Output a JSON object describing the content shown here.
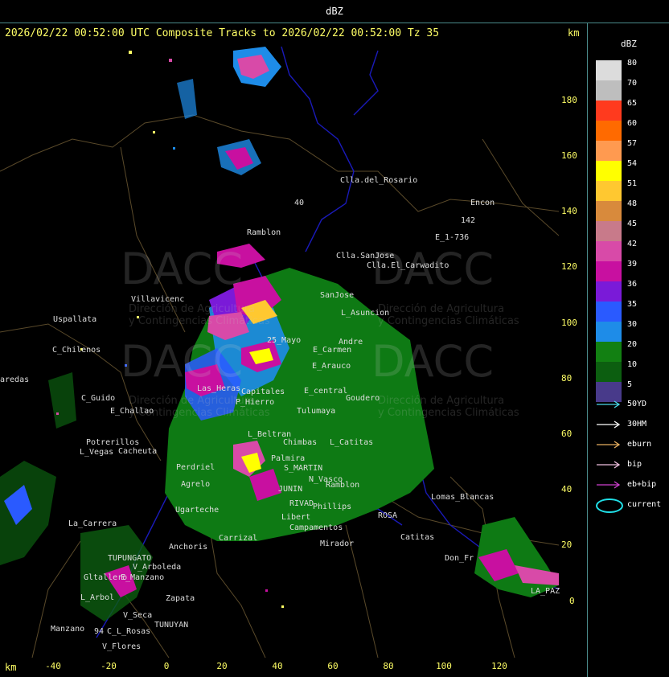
{
  "header": {
    "label": "dBZ"
  },
  "title": "2026/02/22 00:52:00 UTC Composite Tracks to 2026/02/22 00:52:00 Tz 35",
  "km_top": "km",
  "km_bottom": "km",
  "y_ticks": [
    "180",
    "160",
    "140",
    "120",
    "100",
    "80",
    "60",
    "40",
    "20",
    "0"
  ],
  "x_ticks": [
    "-40",
    "-20",
    "0",
    "20",
    "40",
    "60",
    "80",
    "100",
    "120"
  ],
  "legend": {
    "title": "dBZ",
    "levels": [
      {
        "label": "80",
        "color": "#dcdcdc"
      },
      {
        "label": "70",
        "color": "#bebebe"
      },
      {
        "label": "65",
        "color": "#ff3a1e"
      },
      {
        "label": "60",
        "color": "#ff6a00"
      },
      {
        "label": "57",
        "color": "#ff9a50"
      },
      {
        "label": "54",
        "color": "#ffff00"
      },
      {
        "label": "51",
        "color": "#ffc830"
      },
      {
        "label": "48",
        "color": "#d88a3c"
      },
      {
        "label": "45",
        "color": "#c87a8a"
      },
      {
        "label": "42",
        "color": "#d84aa8"
      },
      {
        "label": "39",
        "color": "#c810a0"
      },
      {
        "label": "36",
        "color": "#7a1ad8"
      },
      {
        "label": "35",
        "color": "#2a5aff"
      },
      {
        "label": "30",
        "color": "#1e8ce8"
      },
      {
        "label": "20",
        "color": "#128012"
      },
      {
        "label": "10",
        "color": "#0c5e10"
      },
      {
        "label": "5",
        "color": "#483a8a"
      }
    ]
  },
  "tracks": [
    {
      "label": "50YD",
      "color": "#4ad8e8"
    },
    {
      "label": "30HM",
      "color": "#ffffff"
    },
    {
      "label": "eburn",
      "color": "#e8b060"
    },
    {
      "label": "bip",
      "color": "#f0c0e0"
    },
    {
      "label": "eb+bip",
      "color": "#d040d0"
    },
    {
      "label": "current",
      "color": "#20e0e8"
    }
  ],
  "watermark": {
    "org": "DACC",
    "line1": "Dirección de Agricultura",
    "line2": "y Contingencias Climáticas"
  },
  "places": [
    {
      "name": "Clla.del_Rosario"
    },
    {
      "name": "Encon"
    },
    {
      "name": "142"
    },
    {
      "name": "E_1-736"
    },
    {
      "name": "Ramblon"
    },
    {
      "name": "Clla.SanJose"
    },
    {
      "name": "Clla.El_Carwadito"
    },
    {
      "name": "Villavicenc"
    },
    {
      "name": "Uspallata"
    },
    {
      "name": "C_Chilenos"
    },
    {
      "name": "aredas"
    },
    {
      "name": "SanJose"
    },
    {
      "name": "L_Asuncion"
    },
    {
      "name": "C_Guido"
    },
    {
      "name": "E_Challao"
    },
    {
      "name": "25_Mayo"
    },
    {
      "name": "E_Carmen"
    },
    {
      "name": "Andre"
    },
    {
      "name": "E_Arauco"
    },
    {
      "name": "Las_Heras"
    },
    {
      "name": "P_Hierro"
    },
    {
      "name": "Capitales"
    },
    {
      "name": "E_central"
    },
    {
      "name": "Tulumaya"
    },
    {
      "name": "Goudero"
    },
    {
      "name": "Potrerillos"
    },
    {
      "name": "L_Vegas"
    },
    {
      "name": "Cacheuta"
    },
    {
      "name": "L_Beltran"
    },
    {
      "name": "Chimbas"
    },
    {
      "name": "L_Catitas"
    },
    {
      "name": "Perdriel"
    },
    {
      "name": "Palmira"
    },
    {
      "name": "S_MARTIN"
    },
    {
      "name": "Agrelo"
    },
    {
      "name": "JUNIN"
    },
    {
      "name": "N_Vasco"
    },
    {
      "name": "Ramblon"
    },
    {
      "name": "Ugarteche"
    },
    {
      "name": "RIVAD"
    },
    {
      "name": "Phillips"
    },
    {
      "name": "Lomas_Blancas"
    },
    {
      "name": "La_Carrera"
    },
    {
      "name": "Libert"
    },
    {
      "name": "Campamentos"
    },
    {
      "name": "ROSA"
    },
    {
      "name": "Catitas"
    },
    {
      "name": "Carrizal"
    },
    {
      "name": "Anchoris"
    },
    {
      "name": "Mirador"
    },
    {
      "name": "TUPUNGATO"
    },
    {
      "name": "V_Arboleda"
    },
    {
      "name": "Gltallero"
    },
    {
      "name": "E_Manzano"
    },
    {
      "name": "Don_Fr"
    },
    {
      "name": "Zapata"
    },
    {
      "name": "L_Arbol"
    },
    {
      "name": "V_Seca"
    },
    {
      "name": "TUNUYAN"
    },
    {
      "name": "Manzano"
    },
    {
      "name": "C_L_Rosas"
    },
    {
      "name": "V_Flores"
    },
    {
      "name": "LA_PAZ"
    },
    {
      "name": "40"
    },
    {
      "name": "94"
    }
  ]
}
